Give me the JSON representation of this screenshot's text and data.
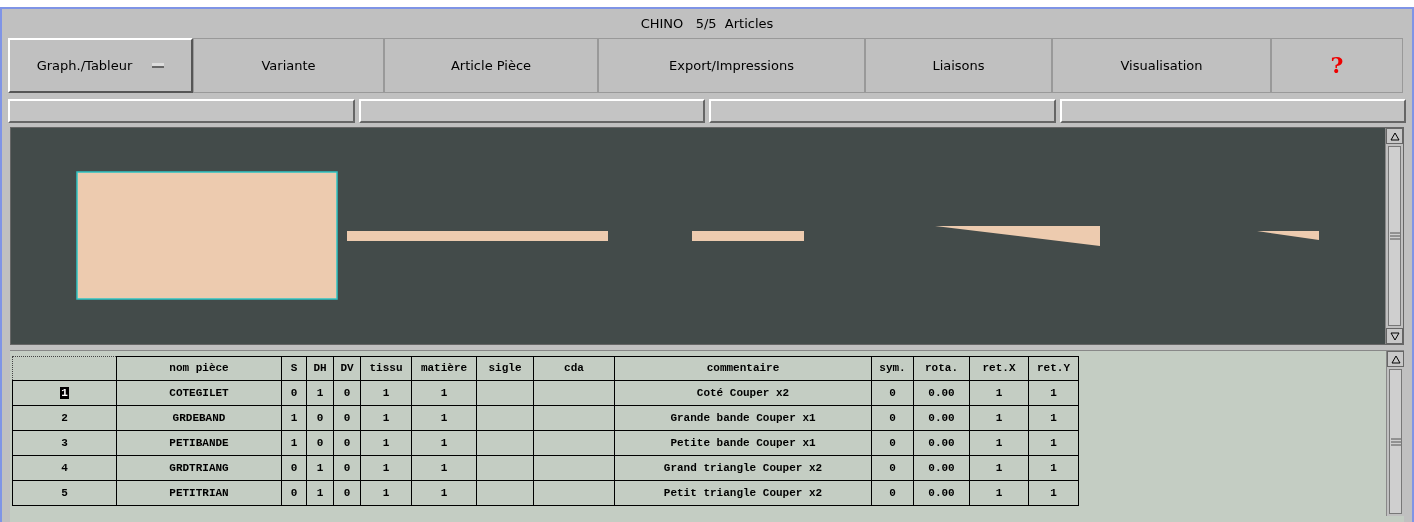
{
  "window": {
    "title": "CHINO   5/5  Articles"
  },
  "toolbar": [
    {
      "label": "Graph./Tableur",
      "kind": "option"
    },
    {
      "label": "Variante",
      "kind": "button"
    },
    {
      "label": "Article Pièce",
      "kind": "button"
    },
    {
      "label": "Export/Impressions",
      "kind": "button"
    },
    {
      "label": "Liaisons",
      "kind": "button"
    },
    {
      "label": "Visualisation",
      "kind": "button"
    },
    {
      "label": "?",
      "kind": "help"
    }
  ],
  "status_fields": [
    {
      "kind": "field"
    },
    {
      "kind": "field"
    },
    {
      "kind": "field"
    },
    {
      "kind": "field"
    }
  ],
  "table": {
    "columns": [
      "nom pièce",
      "S",
      "DH",
      "DV",
      "tissu",
      "matière",
      "sigle",
      "cda",
      "commentaire",
      "sym.",
      "rota.",
      "ret.X",
      "ret.Y"
    ],
    "rows": [
      {
        "index": "1",
        "selected": true,
        "cells": [
          "COTEGILET",
          "0",
          "1",
          "0",
          "1",
          "1",
          "",
          "",
          "Coté Couper x2",
          "0",
          "0.00",
          "1",
          "1"
        ]
      },
      {
        "index": "2",
        "selected": false,
        "cells": [
          "GRDEBAND",
          "1",
          "0",
          "0",
          "1",
          "1",
          "",
          "",
          "Grande bande Couper x1",
          "0",
          "0.00",
          "1",
          "1"
        ]
      },
      {
        "index": "3",
        "selected": false,
        "cells": [
          "PETIBANDE",
          "1",
          "0",
          "0",
          "1",
          "1",
          "",
          "",
          "Petite bande Couper x1",
          "0",
          "0.00",
          "1",
          "1"
        ]
      },
      {
        "index": "4",
        "selected": false,
        "cells": [
          "GRDTRIANG",
          "0",
          "1",
          "0",
          "1",
          "1",
          "",
          "",
          "Grand triangle Couper x2",
          "0",
          "0.00",
          "1",
          "1"
        ]
      },
      {
        "index": "5",
        "selected": false,
        "cells": [
          "PETITRIAN",
          "0",
          "1",
          "0",
          "1",
          "1",
          "",
          "",
          "Petit triangle Couper x2",
          "0",
          "0.00",
          "1",
          "1"
        ]
      }
    ]
  }
}
